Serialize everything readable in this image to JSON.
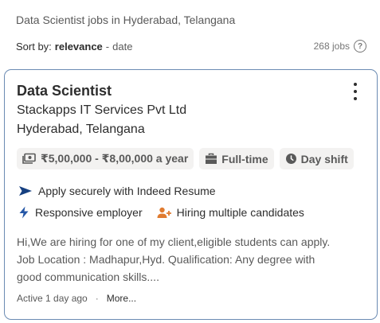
{
  "page": {
    "heading": "Data Scientist jobs in Hyderabad, Telangana"
  },
  "sort": {
    "prefix": "Sort by:",
    "active": "relevance",
    "separator": "-",
    "alternative": "date",
    "job_count": "268 jobs",
    "help_glyph": "?"
  },
  "job": {
    "title": "Data Scientist",
    "company": "Stackapps IT Services Pvt Ltd",
    "location": "Hyderabad, Telangana",
    "salary": "₹5,00,000 - ₹8,00,000 a year",
    "job_type": "Full-time",
    "shift": "Day shift",
    "apply_note": "Apply securely with Indeed Resume",
    "responsive": "Responsive employer",
    "hiring": "Hiring multiple candidates",
    "snippet": "Hi,We are hiring for one of my client,eligible students can apply. Job Location : Madhapur,Hyd. Qualification: Any degree with good communication skills....",
    "posted": "Active 1 day ago",
    "footer_dot": "·",
    "more_label": "More..."
  },
  "icons": {
    "salary": "money-icon",
    "job_type": "briefcase-icon",
    "shift": "clock-icon",
    "apply": "send-arrow-icon",
    "responsive": "lightning-icon",
    "hiring": "people-add-icon",
    "menu": "kebab-menu-icon"
  },
  "colors": {
    "card_border": "#6b8bb3",
    "chip_bg": "#f3f2f1",
    "apply_icon": "#164081",
    "responsive_icon": "#2557a7",
    "hiring_icon": "#e07b30"
  }
}
